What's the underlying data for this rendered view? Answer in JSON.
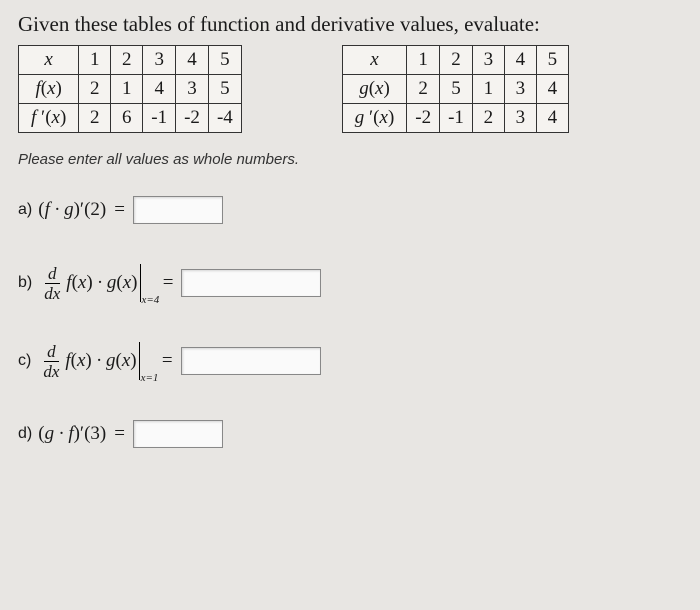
{
  "prompt": "Given these tables of function and derivative values, evaluate:",
  "table_f": {
    "rows": [
      [
        "x",
        "1",
        "2",
        "3",
        "4",
        "5"
      ],
      [
        "f(x)",
        "2",
        "1",
        "4",
        "3",
        "5"
      ],
      [
        "f ′(x)",
        "2",
        "6",
        "-1",
        "-2",
        "-4"
      ]
    ]
  },
  "table_g": {
    "rows": [
      [
        "x",
        "1",
        "2",
        "3",
        "4",
        "5"
      ],
      [
        "g(x)",
        "2",
        "5",
        "1",
        "3",
        "4"
      ],
      [
        "g ′(x)",
        "-2",
        "-1",
        "2",
        "3",
        "4"
      ]
    ]
  },
  "hint": "Please enter all values as whole numbers.",
  "questions": {
    "a": {
      "label": "a)",
      "expr_left": "(f · g)′(2)",
      "eq": "="
    },
    "b": {
      "label": "b)",
      "d": "d",
      "dx": "dx",
      "expr_mid": "f(x) · g(x)",
      "eval_at": "x=4",
      "eq": "="
    },
    "c": {
      "label": "c)",
      "d": "d",
      "dx": "dx",
      "expr_mid": "f(x) · g(x)",
      "eval_at": "x=1",
      "eq": "="
    },
    "d": {
      "label": "d)",
      "expr_left": "(g · f)′(3)",
      "eq": "="
    }
  }
}
